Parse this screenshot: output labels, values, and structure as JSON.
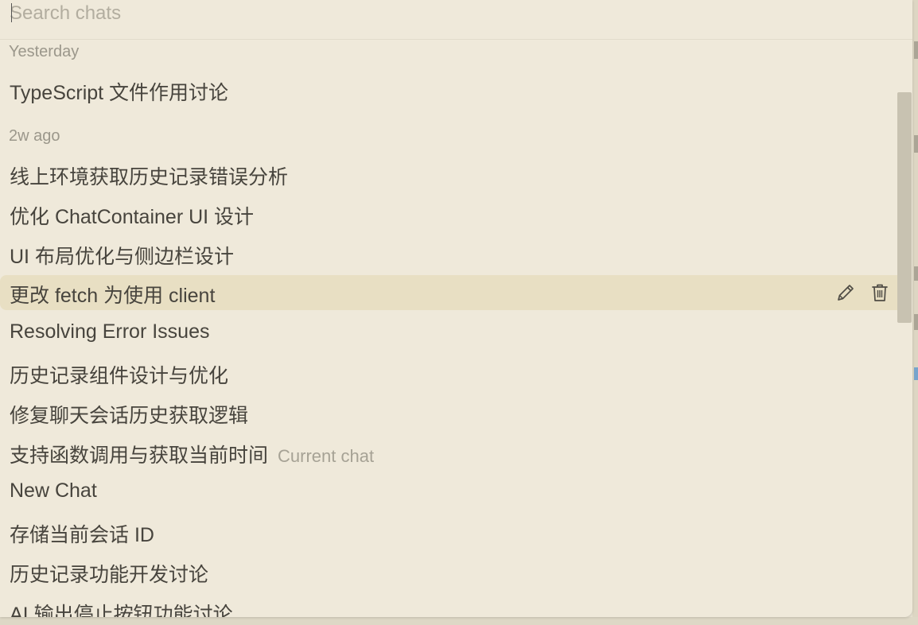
{
  "search": {
    "placeholder": "Search chats",
    "value": ""
  },
  "groups": [
    {
      "label": "Yesterday",
      "items": [
        {
          "title": "TypeScript 文件作用讨论"
        }
      ]
    },
    {
      "label": "2w ago",
      "items": [
        {
          "title": "线上环境获取历史记录错误分析"
        },
        {
          "title": "优化 ChatContainer UI 设计"
        },
        {
          "title": "UI 布局优化与侧边栏设计"
        },
        {
          "title": "更改 fetch 为使用 client"
        },
        {
          "title": "Resolving Error Issues"
        },
        {
          "title": "历史记录组件设计与优化"
        },
        {
          "title": "修复聊天会话历史获取逻辑"
        },
        {
          "title": "支持函数调用与获取当前时间",
          "badge": "Current chat"
        },
        {
          "title": "New Chat"
        },
        {
          "title": "存储当前会话 ID"
        },
        {
          "title": "历史记录功能开发讨论"
        },
        {
          "title": "AI 输出停止按钮功能讨论"
        }
      ]
    }
  ],
  "hovered_item_actions": {
    "edit_icon": "pencil-icon",
    "delete_icon": "trash-icon"
  }
}
